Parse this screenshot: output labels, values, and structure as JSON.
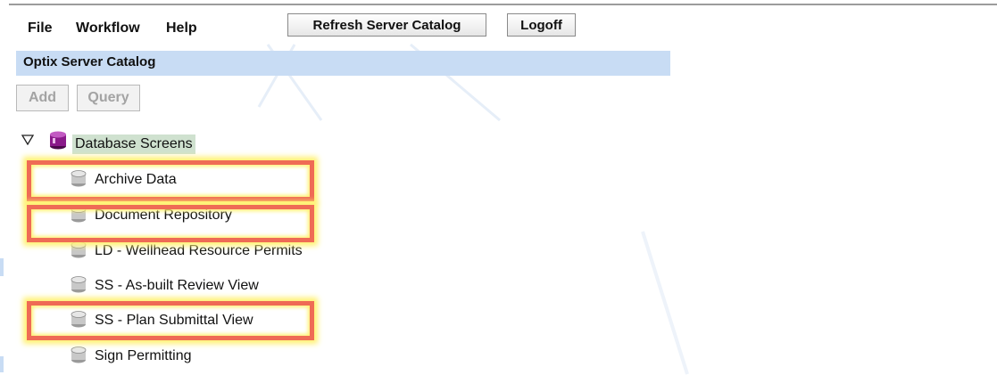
{
  "menu": {
    "file": "File",
    "workflow": "Workflow",
    "help": "Help"
  },
  "toolbar": {
    "refresh": "Refresh Server Catalog",
    "logoff": "Logoff"
  },
  "catalog": {
    "title": "Optix Server Catalog",
    "add": "Add",
    "query": "Query"
  },
  "tree": {
    "root": {
      "label": "Database Screens",
      "icon": "database-purple-icon",
      "expanded": true
    },
    "items": [
      {
        "label": "Archive Data",
        "icon": "database-icon",
        "highlighted": true
      },
      {
        "label": "Document Repository",
        "icon": "database-icon",
        "highlighted": true
      },
      {
        "label": "LD - Wellhead Resource Permits",
        "icon": "database-icon",
        "highlighted": false
      },
      {
        "label": "SS - As-built Review View",
        "icon": "database-icon",
        "highlighted": false
      },
      {
        "label": "SS - Plan Submittal View",
        "icon": "database-icon",
        "highlighted": true
      },
      {
        "label": "Sign Permitting",
        "icon": "database-icon",
        "highlighted": false
      }
    ]
  },
  "colors": {
    "header_bg": "#c8dcf4",
    "highlight_border": "#ef6b55",
    "highlight_glow": "#fff170",
    "root_selected_bg": "#cfe1cf"
  }
}
